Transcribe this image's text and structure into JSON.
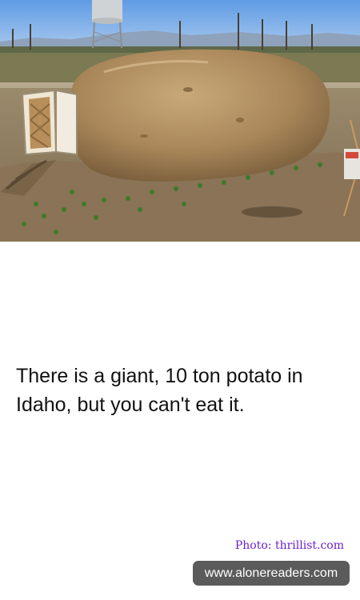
{
  "photo": {
    "subject": "giant-potato-photo"
  },
  "caption": {
    "text": "There is a giant, 10 ton potato in Idaho, but you can't eat it."
  },
  "credit": {
    "text": "Photo: thrillist.com"
  },
  "watermark": {
    "text": "www.alonereaders.com"
  },
  "colors": {
    "credit": "#6a1fd0",
    "watermark_bg": "#5b5b5b",
    "caption": "#111111"
  }
}
